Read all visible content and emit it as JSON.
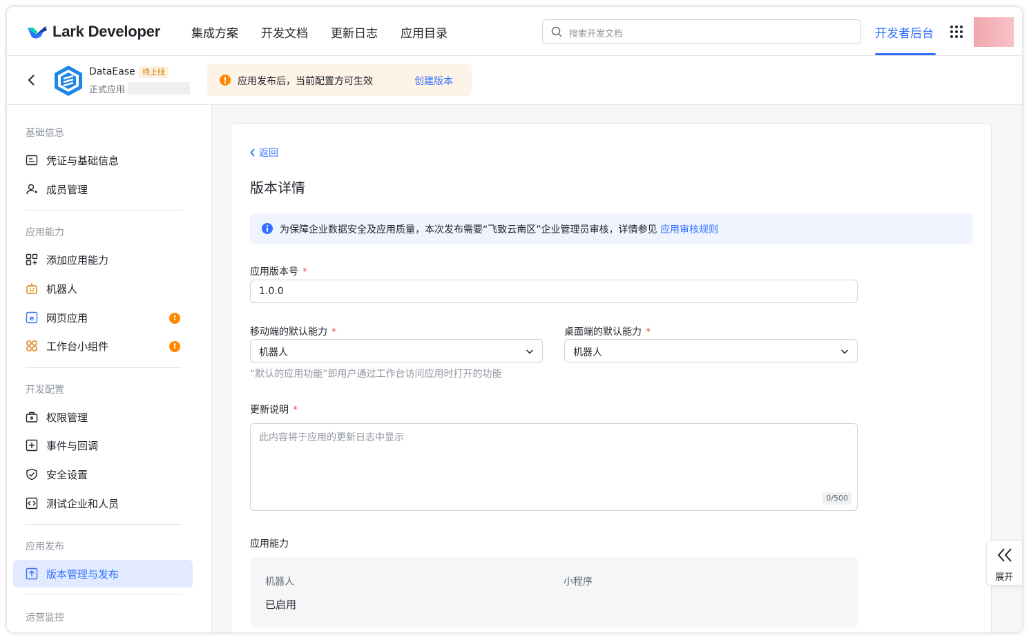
{
  "header": {
    "brand": "Lark Developer",
    "nav": [
      "集成方案",
      "开发文档",
      "更新日志",
      "应用目录"
    ],
    "search_placeholder": "搜索开发文档",
    "dev_console": "开发者后台"
  },
  "app": {
    "name": "DataEase",
    "status_tag": "待上线",
    "type": "正式应用",
    "notice": "应用发布后，当前配置方可生效",
    "notice_link": "创建版本"
  },
  "sidebar": {
    "sections": [
      {
        "title": "基础信息",
        "items": [
          {
            "label": "凭证与基础信息",
            "icon": "credential-icon"
          },
          {
            "label": "成员管理",
            "icon": "member-icon"
          }
        ]
      },
      {
        "title": "应用能力",
        "items": [
          {
            "label": "添加应用能力",
            "icon": "add-capability-icon"
          },
          {
            "label": "机器人",
            "icon": "robot-icon"
          },
          {
            "label": "网页应用",
            "icon": "web-app-icon",
            "badge": "!"
          },
          {
            "label": "工作台小组件",
            "icon": "widget-icon",
            "badge": "!"
          }
        ]
      },
      {
        "title": "开发配置",
        "items": [
          {
            "label": "权限管理",
            "icon": "permission-icon"
          },
          {
            "label": "事件与回调",
            "icon": "event-icon"
          },
          {
            "label": "安全设置",
            "icon": "shield-icon"
          },
          {
            "label": "测试企业和人员",
            "icon": "test-icon"
          }
        ]
      },
      {
        "title": "应用发布",
        "items": [
          {
            "label": "版本管理与发布",
            "icon": "upload-icon",
            "active": true
          }
        ]
      },
      {
        "title": "运营监控",
        "items": []
      }
    ]
  },
  "main": {
    "back": "返回",
    "title": "版本详情",
    "info_text": "为保障企业数据安全及应用质量，本次发布需要“飞致云南区”企业管理员审核，详情参见",
    "info_link": "应用审核规则",
    "version_label": "应用版本号",
    "version_value": "1.0.0",
    "mobile_label": "移动端的默认能力",
    "mobile_value": "机器人",
    "desktop_label": "桌面端的默认能力",
    "desktop_value": "机器人",
    "hint": "“默认的应用功能”即用户通过工作台访问应用时打开的功能",
    "notes_label": "更新说明",
    "notes_placeholder": "此内容将于应用的更新日志中显示",
    "notes_count": "0/500",
    "capability_label": "应用能力",
    "capabilities": [
      {
        "name": "机器人",
        "status": "已启用"
      },
      {
        "name": "小程序",
        "status": ""
      }
    ]
  },
  "expand_label": "展开",
  "colors": {
    "accent": "#3370ff",
    "warning": "#ff8800",
    "required": "#f54a45"
  }
}
